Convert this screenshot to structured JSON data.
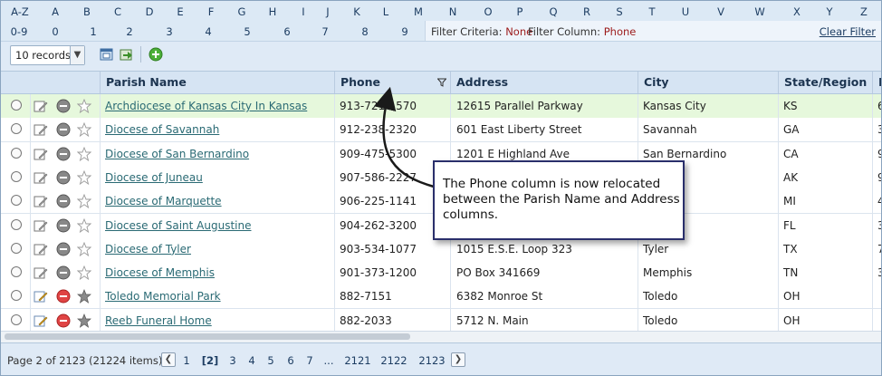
{
  "alpha": {
    "letters": [
      "A-Z",
      "A",
      "B",
      "C",
      "D",
      "E",
      "F",
      "G",
      "H",
      "I",
      "J",
      "K",
      "L",
      "M",
      "N",
      "O",
      "P",
      "Q",
      "R",
      "S",
      "T",
      "U",
      "V",
      "W",
      "X",
      "Y",
      "Z"
    ],
    "digits": [
      "0-9",
      "0",
      "1",
      "2",
      "3",
      "4",
      "5",
      "6",
      "7",
      "8",
      "9"
    ]
  },
  "filter": {
    "criteria_label": "Filter Criteria:",
    "criteria_value": "None",
    "column_label": "Filter Column:",
    "column_value": "Phone",
    "clear": "Clear Filter"
  },
  "toolbar": {
    "records": "10 records"
  },
  "grid": {
    "headers": {
      "parish": "Parish Name",
      "phone": "Phone",
      "address": "Address",
      "city": "City",
      "state": "State/Region",
      "extra": "P"
    },
    "rows": [
      {
        "name": "Archdiocese of Kansas City In Kansas",
        "phone": "913-721-1570",
        "address": "12615 Parallel Parkway",
        "city": "Kansas City",
        "state": "KS",
        "extra": "6",
        "type": "diocese"
      },
      {
        "name": "Diocese of Savannah",
        "phone": "912-238-2320",
        "address": "601 East Liberty Street",
        "city": "Savannah",
        "state": "GA",
        "extra": "3",
        "type": "diocese"
      },
      {
        "name": "Diocese of San Bernardino",
        "phone": "909-475-5300",
        "address": "1201 E Highland Ave",
        "city": "San Bernardino",
        "state": "CA",
        "extra": "9",
        "type": "diocese"
      },
      {
        "name": "Diocese of Juneau",
        "phone": "907-586-2227",
        "address": "",
        "city": "",
        "state": "AK",
        "extra": "9",
        "type": "diocese"
      },
      {
        "name": "Diocese of Marquette",
        "phone": "906-225-1141",
        "address": "",
        "city": "e",
        "state": "MI",
        "extra": "4",
        "type": "diocese"
      },
      {
        "name": "Diocese of Saint Augustine",
        "phone": "904-262-3200",
        "address": "",
        "city": "lle",
        "state": "FL",
        "extra": "3",
        "type": "diocese"
      },
      {
        "name": "Diocese of Tyler",
        "phone": "903-534-1077",
        "address": "1015 E.S.E. Loop 323",
        "city": "Tyler",
        "state": "TX",
        "extra": "7",
        "type": "diocese"
      },
      {
        "name": "Diocese of Memphis",
        "phone": "901-373-1200",
        "address": "PO Box 341669",
        "city": "Memphis",
        "state": "TN",
        "extra": "3",
        "type": "diocese"
      },
      {
        "name": "Toledo Memorial Park",
        "phone": "882-7151",
        "address": "6382 Monroe St",
        "city": "Toledo",
        "state": "OH",
        "extra": "",
        "type": "cemetery"
      },
      {
        "name": "Reeb Funeral Home",
        "phone": "882-2033",
        "address": "5712 N. Main",
        "city": "Toledo",
        "state": "OH",
        "extra": "",
        "type": "cemetery"
      }
    ]
  },
  "pager": {
    "info": "Page 2 of 2123 (21224 items)",
    "pages": [
      "1",
      "[2]",
      "3",
      "4",
      "5",
      "6",
      "7",
      "...",
      "2121",
      "2122",
      "2123"
    ]
  },
  "callout": {
    "text": "The Phone column is now relocated between the Parish Name and Address columns."
  },
  "colors": {
    "selected_row": "#e6f8dc",
    "link": "#2a6a74",
    "filter_value": "#9c1b1b",
    "header_bg": "#d6e4f3"
  }
}
